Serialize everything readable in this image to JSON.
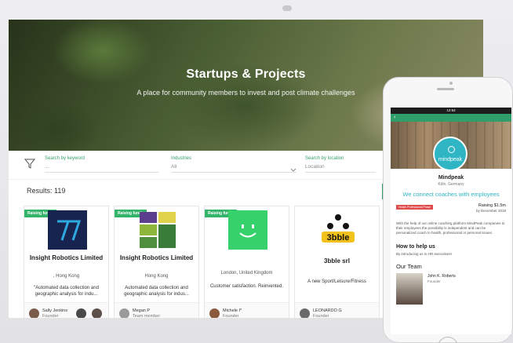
{
  "hero": {
    "title": "Startups & Projects",
    "subtitle": "A place for community members to invest and post climate challenges"
  },
  "filters": {
    "keyword_label": "Search by keyword",
    "keyword_value": "...",
    "industries_label": "Industries",
    "industries_value": "All",
    "location_label": "Search by location",
    "location_value": "Location"
  },
  "results_label": "Results: 119",
  "cards": [
    {
      "badge": "Raising funds",
      "name": "Insight Robotics Limited",
      "location": ", Hong Kong",
      "description": "\"Automated data collection and geographic analysis for indu...",
      "person": "Sally Jenkins",
      "role": "Founder"
    },
    {
      "badge": "Raising funds",
      "name": "Insight Robotics Limited",
      "location": "Hong Kong",
      "description": "Automated data collection and geographic analysis for indus...",
      "person": "Megan P",
      "role": "Team member"
    },
    {
      "badge": "Raising funds",
      "name": "",
      "location": "London, United Kingdom",
      "description": "Customer satisfaction. Reinvented.",
      "person": "Michele I*",
      "role": "Founder"
    },
    {
      "badge": "",
      "name": "3bble srl",
      "location": "",
      "description": "A new Sport/Leisure/Fitness",
      "person": "LEONARDO G",
      "role": "Founder"
    }
  ],
  "phone": {
    "time": "12:54",
    "logo_text": "mindpeak",
    "company": "Mindpeak",
    "company_location": "Köln, Germany",
    "tagline": "We connect coaches with employees",
    "tag": "Health Professional Phase",
    "raising": "Raising $1.5m",
    "raising_by": "by December 2018",
    "about": "With the help of our online coaching platform MindPeak companies to their employees the possibility is independent and can be personalized coach to health, professional or personal issues.",
    "help_title": "How to help us",
    "help_text": "By introducing us to HR executives!",
    "team_title": "Our Team",
    "member_name": "John K. Roberts",
    "member_role": "Founder"
  },
  "colors": {
    "accent": "#34a06d",
    "badge": "#34b36a",
    "mindpeak": "#2fb5c4"
  }
}
